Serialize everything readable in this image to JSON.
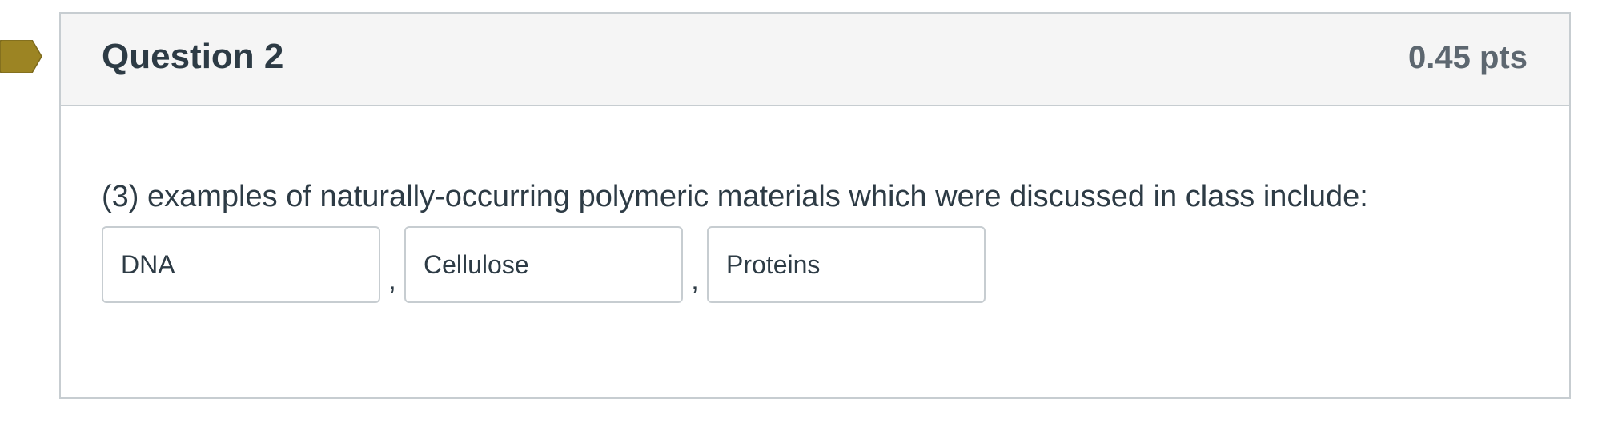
{
  "question": {
    "title": "Question 2",
    "points": "0.45 pts",
    "text": "(3) examples of naturally-occurring polymeric materials which were discussed in class include:",
    "answers": [
      "DNA",
      "Cellulose",
      "Proteins"
    ],
    "separator": ","
  },
  "flag": {
    "icon": "bookmark-flag-icon",
    "color": "#9c8423"
  },
  "colors": {
    "header_bg": "#f5f5f5",
    "border": "#c7cdd1",
    "text": "#2d3b45",
    "points_text": "#5d6770"
  }
}
